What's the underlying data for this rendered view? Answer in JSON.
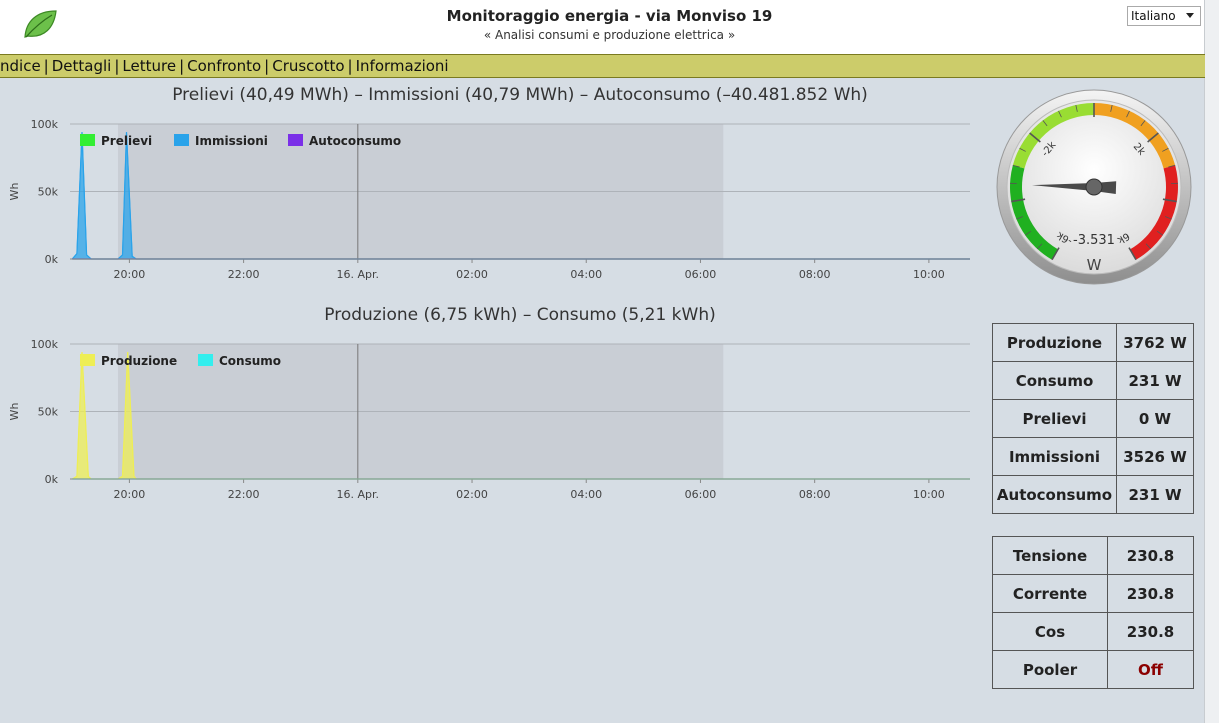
{
  "header": {
    "title": "Monitoraggio energia - via Monviso 19",
    "subtitle": "« Analisi consumi e produzione elettrica »",
    "language": "Italiano"
  },
  "nav": {
    "items": [
      "ndice",
      "Dettagli",
      "Letture",
      "Confronto",
      "Cruscotto",
      "Informazioni"
    ]
  },
  "chart_data": [
    {
      "type": "area",
      "title": "Prelievi (40,49 MWh) – Immissioni (40,79 MWh) – Autoconsumo (–40.481.852 Wh)",
      "ylabel": "Wh",
      "xlabel": "",
      "ylim": [
        0,
        100000
      ],
      "y_ticks": [
        "0k",
        "50k",
        "100k"
      ],
      "x_ticks": [
        "20:00",
        "22:00",
        "16. Apr.",
        "02:00",
        "04:00",
        "06:00",
        "08:00",
        "10:00"
      ],
      "xlim_hours": [
        18.96,
        34.72
      ],
      "shaded_band_hours": [
        19.8,
        30.4
      ],
      "grid": true,
      "legend": "top-left",
      "series": [
        {
          "name": "Prelievi",
          "color": "#33ee33",
          "points": [
            [
              19.0,
              0
            ],
            [
              19.5,
              0
            ],
            [
              20.0,
              0
            ],
            [
              34.72,
              0
            ]
          ]
        },
        {
          "name": "Immissioni",
          "color": "#2aa3ea",
          "points": [
            [
              19.0,
              0
            ],
            [
              19.08,
              4000
            ],
            [
              19.17,
              94000
            ],
            [
              19.25,
              3000
            ],
            [
              19.33,
              0
            ],
            [
              19.8,
              0
            ],
            [
              19.88,
              3000
            ],
            [
              19.95,
              94000
            ],
            [
              20.05,
              2000
            ],
            [
              20.12,
              0
            ],
            [
              34.72,
              0
            ]
          ]
        },
        {
          "name": "Autoconsumo",
          "color": "#7a2fe8",
          "points": [
            [
              19.0,
              0
            ],
            [
              34.72,
              0
            ]
          ]
        }
      ]
    },
    {
      "type": "area",
      "title": "Produzione (6,75 kWh) – Consumo (5,21 kWh)",
      "ylabel": "Wh",
      "xlabel": "",
      "ylim": [
        0,
        100000
      ],
      "y_ticks": [
        "0k",
        "50k",
        "100k"
      ],
      "x_ticks": [
        "20:00",
        "22:00",
        "16. Apr.",
        "02:00",
        "04:00",
        "06:00",
        "08:00",
        "10:00"
      ],
      "xlim_hours": [
        18.96,
        34.72
      ],
      "shaded_band_hours": [
        19.8,
        30.4
      ],
      "grid": true,
      "legend": "top-left",
      "series": [
        {
          "name": "Produzione",
          "color": "#eeee55",
          "points": [
            [
              19.0,
              0
            ],
            [
              19.08,
              2000
            ],
            [
              19.17,
              94000
            ],
            [
              19.28,
              2000
            ],
            [
              19.33,
              0
            ],
            [
              19.8,
              0
            ],
            [
              19.88,
              2000
            ],
            [
              19.97,
              94000
            ],
            [
              20.08,
              2000
            ],
            [
              20.12,
              0
            ],
            [
              34.72,
              0
            ]
          ]
        },
        {
          "name": "Consumo",
          "color": "#33eeee",
          "points": [
            [
              19.0,
              0
            ],
            [
              34.72,
              0
            ]
          ]
        }
      ]
    }
  ],
  "gauge": {
    "value": -3531,
    "value_text": "-3.531",
    "unit": "W",
    "min": -6000,
    "max": 6000,
    "tick_labels": [
      "-6k",
      "-2k",
      "2k",
      "6k"
    ],
    "colors": {
      "green": "#20b020",
      "lightgreen": "#99dd33",
      "orange": "#f0a020",
      "red": "#e02020"
    }
  },
  "power_table": [
    {
      "label": "Produzione",
      "value": "3762 W"
    },
    {
      "label": "Consumo",
      "value": "231 W"
    },
    {
      "label": "Prelievi",
      "value": "0 W"
    },
    {
      "label": "Immissioni",
      "value": "3526 W"
    },
    {
      "label": "Autoconsumo",
      "value": "231 W"
    }
  ],
  "elec_table": [
    {
      "label": "Tensione",
      "value": "230.8"
    },
    {
      "label": "Corrente",
      "value": "230.8"
    },
    {
      "label": "Cos",
      "value": "230.8"
    },
    {
      "label": "Pooler",
      "value": "Off"
    }
  ]
}
